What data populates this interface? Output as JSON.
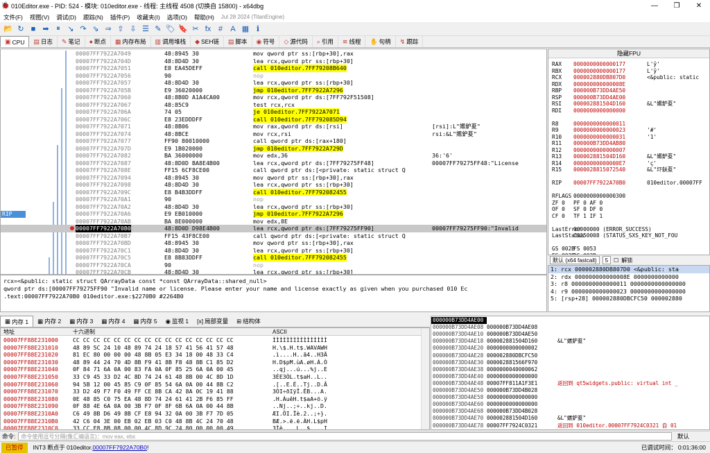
{
  "window": {
    "title": "010Editor.exe - PID: 524 - 模块: 010editor.exe - 线程: 主线程 4508 (切换自 15800) - x64dbg"
  },
  "menu": [
    "文件(F)",
    "视图(V)",
    "调试(D)",
    "跟踪(N)",
    "插件(P)",
    "收藏夹(I)",
    "选项(O)",
    "帮助(H)"
  ],
  "build": "Jul 28 2024 (TitanEngine)",
  "toolbar_icons": [
    "open-icon",
    "restart-icon",
    "close-icon",
    "run-icon",
    "pause-icon",
    "step-into-icon",
    "step-over-icon",
    "trace-into-icon",
    "trace-over-icon",
    "run-to-user-icon",
    "script-icon",
    "patch-icon",
    "comment-icon",
    "label-icon",
    "bookmark-icon",
    "function-icon",
    "fx",
    "hash",
    "A",
    "font-icon",
    "calc-icon",
    "info-icon"
  ],
  "toolbar_text": {
    "fx": "fx",
    "hash": "#",
    "A": "A"
  },
  "tabs": [
    "CPU",
    "日志",
    "笔记",
    "断点",
    "内存布局",
    "调用堆栈",
    "SEH链",
    "脚本",
    "符号",
    "源代码",
    "引用",
    "线程",
    "句柄",
    "跟踪"
  ],
  "disasm": [
    {
      "addr": "00007FF7922A7049",
      "bytes": "48:8945 30",
      "ins": "mov qword ptr ss:[rbp+30],rax",
      "cls": "",
      "cmt": ""
    },
    {
      "addr": "00007FF7922A704D",
      "bytes": "48:8D4D 30",
      "ins": "lea rcx,qword ptr ss:[rbp+30]",
      "cls": "",
      "cmt": ""
    },
    {
      "addr": "00007FF7922A7051",
      "bytes": "E8 EA45DEFF",
      "ins": "call 010editor.7FF79208B640",
      "cls": "hlc",
      "cmt": ""
    },
    {
      "addr": "00007FF7922A7056",
      "bytes": "90",
      "ins": "nop",
      "cls": "gray",
      "cmt": ""
    },
    {
      "addr": "00007FF7922A7057",
      "bytes": "48:8D4D 30",
      "ins": "lea rcx,qword ptr ss:[rbp+30]",
      "cls": "",
      "cmt": ""
    },
    {
      "addr": "00007FF7922A705B",
      "bytes": "E9 36020000",
      "ins": "jmp 010editor.7FF7922A7296",
      "cls": "hlc",
      "cmt": ""
    },
    {
      "addr": "00007FF7922A7060",
      "bytes": "48:8B0D A1A4CA00",
      "ins": "mov rcx,qword ptr ds:[7FF792F51508]",
      "cls": "",
      "cmt": ""
    },
    {
      "addr": "00007FF7922A7067",
      "bytes": "48:85C9",
      "ins": "test rcx,rcx",
      "cls": "",
      "cmt": ""
    },
    {
      "addr": "00007FF7922A706A",
      "bytes": "74 05",
      "ins": "je 010editor.7FF7922A7071",
      "cls": "hlc",
      "cmt": ""
    },
    {
      "addr": "00007FF7922A706C",
      "bytes": "E8 23EDDDFF",
      "ins": "call 010editor.7FF792085D94",
      "cls": "hlc",
      "cmt": ""
    },
    {
      "addr": "00007FF7922A7071",
      "bytes": "48:8B06",
      "ins": "mov rax,qword ptr ds:[rsi]",
      "cls": "",
      "cmt": "[rsi]:L\"嬺鈩荾\""
    },
    {
      "addr": "00007FF7922A7074",
      "bytes": "48:8BCE",
      "ins": "mov rcx,rsi",
      "cls": "",
      "cmt": "rsi:&L\"嬺鈩荾\""
    },
    {
      "addr": "00007FF7922A7077",
      "bytes": "FF90 80010000",
      "ins": "call qword ptr ds:[rax+180]",
      "cls": "",
      "cmt": ""
    },
    {
      "addr": "00007FF7922A707D",
      "bytes": "E9 1B020000",
      "ins": "jmp 010editor.7FF7922A729D",
      "cls": "hlc",
      "cmt": ""
    },
    {
      "addr": "00007FF7922A7082",
      "bytes": "BA 36000000",
      "ins": "mov edx,36",
      "cls": "",
      "cmt": "36:'6'"
    },
    {
      "addr": "00007FF7922A7087",
      "bytes": "48:8D0D BA8E4B00",
      "ins": "lea rcx,qword ptr ds:[7FF79275FF48]",
      "cls": "",
      "cmt": "00007FF79275FF48:\"License"
    },
    {
      "addr": "00007FF7922A708E",
      "bytes": "FF15 6CF8CE00",
      "ins": "call qword ptr ds:[<private: static struct Q",
      "cls": "",
      "cmt": ""
    },
    {
      "addr": "00007FF7922A7094",
      "bytes": "48:8945 30",
      "ins": "mov qword ptr ss:[rbp+30],rax",
      "cls": "",
      "cmt": ""
    },
    {
      "addr": "00007FF7922A7098",
      "bytes": "48:8D4D 30",
      "ins": "lea rcx,qword ptr ss:[rbp+30]",
      "cls": "",
      "cmt": ""
    },
    {
      "addr": "00007FF7922A709C",
      "bytes": "E8 B4B3DDFF",
      "ins": "call 010editor.7FF792082455",
      "cls": "hlc",
      "cmt": ""
    },
    {
      "addr": "00007FF7922A70A1",
      "bytes": "90",
      "ins": "nop",
      "cls": "gray",
      "cmt": ""
    },
    {
      "addr": "00007FF7922A70A2",
      "bytes": "48:8D4D 30",
      "ins": "lea rcx,qword ptr ss:[rbp+30]",
      "cls": "",
      "cmt": ""
    },
    {
      "addr": "00007FF7922A70A6",
      "bytes": "E9 EB010000",
      "ins": "jmp 010editor.7FF7922A7296",
      "cls": "hlc",
      "cmt": ""
    },
    {
      "addr": "00007FF7922A70AB",
      "bytes": "BA 8E000000",
      "ins": "mov edx,8E",
      "cls": "",
      "cmt": ""
    },
    {
      "addr": "00007FF7922A70B0",
      "bytes": "48:8D0D D98E4B00",
      "ins": "lea rcx,qword ptr ds:[7FF79275FF90]",
      "cls": "",
      "cmt": "00007FF79275FF90:\"Invalid"
    },
    {
      "addr": "00007FF7922A70B7",
      "bytes": "FF15 43F8CE00",
      "ins": "call qword ptr ds:[<private: static struct Q",
      "cls": "",
      "cmt": ""
    },
    {
      "addr": "00007FF7922A70BD",
      "bytes": "48:8945 30",
      "ins": "mov qword ptr ss:[rbp+30],rax",
      "cls": "",
      "cmt": ""
    },
    {
      "addr": "00007FF7922A70C1",
      "bytes": "48:8D4D 30",
      "ins": "lea rcx,qword ptr ss:[rbp+30]",
      "cls": "",
      "cmt": ""
    },
    {
      "addr": "00007FF7922A70C5",
      "bytes": "E8 8B83DDFF",
      "ins": "call 010editor.7FF792082455",
      "cls": "hlc",
      "cmt": ""
    },
    {
      "addr": "00007FF7922A70CA",
      "bytes": "90",
      "ins": "nop",
      "cls": "gray",
      "cmt": ""
    },
    {
      "addr": "00007FF7922A70CB",
      "bytes": "48:8D4D 30",
      "ins": "lea rcx,qword ptr ss:[rbp+30]",
      "cls": "",
      "cmt": ""
    },
    {
      "addr": "00007FF7922A70CF",
      "bytes": "E9 C2010000",
      "ins": "jmp 010editor.7FF7922A7296",
      "cls": "hlc",
      "cmt": ""
    }
  ],
  "rip_label": "RIP",
  "rip_row": 24,
  "regs_header": "隐藏FPU",
  "regs": [
    {
      "n": "RAX",
      "v": "0000000000000177",
      "c": "L'ŷ'"
    },
    {
      "n": "RBX",
      "v": "0000000000000177",
      "c": "L'ŷ'"
    },
    {
      "n": "RCX",
      "v": "000002880DB807D0",
      "c": "<&public: static"
    },
    {
      "n": "RDX",
      "v": "000000000000008E",
      "c": ""
    },
    {
      "n": "RBP",
      "v": "000000B73DD4AE50",
      "c": ""
    },
    {
      "n": "RSP",
      "v": "000000B73DD4AE00",
      "c": ""
    },
    {
      "n": "RSI",
      "v": "000002881504D160",
      "c": "&L\"嬺鈩荾\""
    },
    {
      "n": "RDI",
      "v": "0000000000000000",
      "c": ""
    },
    {
      "n": "",
      "v": "",
      "c": ""
    },
    {
      "n": "R8",
      "v": "0000000000000011",
      "c": ""
    },
    {
      "n": "R9",
      "v": "0000000000000023",
      "c": "'#'"
    },
    {
      "n": "R10",
      "v": "0000000000000031",
      "c": "'1'"
    },
    {
      "n": "R11",
      "v": "000000B73DD4AB80",
      "c": ""
    },
    {
      "n": "R12",
      "v": "0000000000000007",
      "c": ""
    },
    {
      "n": "R13",
      "v": "000002881504D160",
      "c": "&L\"嬺鈩荾\""
    },
    {
      "n": "R14",
      "v": "00000000000000E7",
      "c": "'ç'"
    },
    {
      "n": "R15",
      "v": "0000028815072540",
      "c": "&L\"圷鈇荾\""
    },
    {
      "n": "",
      "v": "",
      "c": ""
    },
    {
      "n": "RIP",
      "v": "00007FF7922A70B0",
      "c": "010editor.00007FF"
    },
    {
      "n": "",
      "v": "",
      "c": ""
    },
    {
      "n": "RFLAGS",
      "v": "0000000000000300",
      "c": ""
    },
    {
      "n": "ZF 0",
      "v": "PF 0   AF 0",
      "c": ""
    },
    {
      "n": "OF 0",
      "v": "SF 0   DF 0",
      "c": ""
    },
    {
      "n": "CF 0",
      "v": "TF 1   IF 1",
      "c": ""
    },
    {
      "n": "",
      "v": "",
      "c": ""
    },
    {
      "n": "LastError",
      "v": "  00000000 (ERROR_SUCCESS)",
      "c": ""
    },
    {
      "n": "LastStatus",
      "v": "  C0150008 (STATUS_SXS_KEY_NOT_FOU",
      "c": ""
    },
    {
      "n": "",
      "v": "",
      "c": ""
    },
    {
      "n": "GS 002B",
      "v": "FS 0053",
      "c": ""
    },
    {
      "n": "ES 002B",
      "v": "DS 002B",
      "c": ""
    }
  ],
  "fastcall": {
    "label": "默认 (x64 fastcall)",
    "count": "5",
    "unlock": "解锁"
  },
  "args": [
    "1: rcx 000002880DB807D0 <&public: sta",
    "2: rdx 000000000000008E 0000000000000",
    "3: r8 0000000000000011 0000000000000000",
    "4: r9 0000000000000023 0000000000000000",
    "5: [rsp+28] 000002880DBCFC50 000002880"
  ],
  "info": {
    "l1": "rcx=<&public: static struct QArrayData const *const QArrayData::shared_null>",
    "l2": "qword ptr ds:[00007FF79275FF90 \"Invalid name or license. Please enter your name and license exactly as given when you purchased 010 Ec",
    "l3": "",
    ".text": ".text:00007FF7922A70B0 010editor.exe:$2270B0 #2264B0"
  },
  "dumptabs": [
    "内存 1",
    "内存 2",
    "内存 3",
    "内存 4",
    "内存 5",
    "监视 1",
    "局部变量",
    "结构体"
  ],
  "dump_headers": {
    "addr": "地址",
    "hex": "十六进制",
    "ascii": "ASCII"
  },
  "dump": [
    {
      "a": "00007FF88E231000",
      "h": "CC CC CC CC CC CC CC CC CC CC CC CC CC CC CC CC",
      "s": "ÌÌÌÌÌÌÌÌÌÌÌÌÌÌÌÌ"
    },
    {
      "a": "00007FF88E231010",
      "h": "48 89 5C 24 10 48 89 74 24 18 57 41 56 41 57 48",
      "s": "H.\\$.H.t$.WAVAWH"
    },
    {
      "a": "00007FF88E231020",
      "h": "81 EC 80 00 00 00 48 8B 05 E3 34 18 00 48 33 C4",
      "s": ".ì....H..ã4..H3Ä"
    },
    {
      "a": "00007FF88E231030",
      "h": "48 89 44 24 70 4D 8B F9 41 8B F8 48 8B C1 85 D2",
      "s": "H.D$pM.ùA.øH.Á.Ò"
    },
    {
      "a": "00007FF88E231040",
      "h": "0F 84 71 6A 0A 00 83 FA 0A 0F 85 25 6A 0A 00 45",
      "s": "..qj...ú...%j..E"
    },
    {
      "a": "00007FF88E231050",
      "h": "33 C9 45 33 D2 4C 8D 74 24 61 48 8B 00 4C 8D 1D",
      "s": "3ÉE3ÒL.t$aH..L.."
    },
    {
      "a": "00007FF88E231060",
      "h": "94 5B 12 00 45 85 C9 0F 85 54 6A 0A 00 44 8B C2",
      "s": ".[..E.É..Tj..D.Â"
    },
    {
      "a": "00007FF88E231070",
      "h": "33 D2 49 F7 F0 49 FF CE 8B CA 42 8A 0C 19 41 88",
      "s": "3ÒI÷ðIÿÎ.ÊB...A."
    },
    {
      "a": "00007FF88E231080",
      "h": "0E 48 85 C0 75 EA 48 8D 74 24 61 41 2B F6 85 FF",
      "s": ".H.ÀuêH.t$aA+ö.ÿ"
    },
    {
      "a": "00007FF88E231090",
      "h": "0F 88 4E 6A 0A 00 3B F7 0F 8F 6B 6A 0A 00 44 8B",
      "s": "..Nj..;÷..kj..D."
    },
    {
      "a": "00007FF88E2310A0",
      "h": "C6 49 8B D6 49 8B CF E8 94 32 0A 00 3B F7 7D 05",
      "s": "ÆI.ÖI.Ïè.2..;÷}."
    },
    {
      "a": "00007FF88E2310B0",
      "h": "42 C6 04 3E 00 EB 02 EB 03 C0 48 8B 4C 24 70 48",
      "s": "BÆ.>.ë.ë.ÀH.L$pH"
    },
    {
      "a": "00007FF88E2310C0",
      "h": "33 CC E8 8B 08 00 00 4C 8D 9C 24 80 00 00 00 49",
      "s": "3Ìè....L..$....I"
    },
    {
      "a": "00007FF88E2310D0",
      "h": "8B 5B 28 49 8B 73 30 49 8B E3 41 5F 41 5E 5F C3",
      "s": ".[(I.s0I.ãA_A^_Ã"
    }
  ],
  "stack": [
    {
      "a": "000000B73DD4AE00",
      "v": "000000B73DD4AE00",
      "c": ""
    },
    {
      "a": "000000B73DD4AE08",
      "v": "000000B73DD4AE08",
      "c": ""
    },
    {
      "a": "000000B73DD4AE10",
      "v": "000000B73DD4AE50",
      "c": ""
    },
    {
      "a": "000000B73DD4AE18",
      "v": "000002881504D160",
      "c": "&L\"嬺鈩荾\""
    },
    {
      "a": "000000B73DD4AE20",
      "v": "0000000000000002",
      "c": ""
    },
    {
      "a": "000000B73DD4AE28",
      "v": "000002880DBCFC50",
      "c": ""
    },
    {
      "a": "000000B73DD4AE30",
      "v": "000002881566F970",
      "c": ""
    },
    {
      "a": "000000B73DD4AE38",
      "v": "0000000040000062",
      "c": ""
    },
    {
      "a": "000000B73DD4AE40",
      "v": "0000000000000000",
      "c": ""
    },
    {
      "a": "000000B73DD4AE48",
      "v": "00007FF811A1F3E1",
      "c": "返回到 qt5widgets.public: virtual int _"
    },
    {
      "a": "000000B73DD4AE50",
      "v": "000000B73DD4B028",
      "c": ""
    },
    {
      "a": "000000B73DD4AE58",
      "v": "0000000000000000",
      "c": ""
    },
    {
      "a": "000000B73DD4AE60",
      "v": "0000000000000000",
      "c": ""
    },
    {
      "a": "000000B73DD4AE68",
      "v": "000000B73DD4B028",
      "c": ""
    },
    {
      "a": "000000B73DD4AE70",
      "v": "000002881504D160",
      "c": "&L\"嬺鈩荾\""
    },
    {
      "a": "000000B73DD4AE78",
      "v": "00007FF7924C0321",
      "c": "返回到 010editor.00007FF7924C0321 自 01"
    }
  ],
  "cmd": {
    "label": "命令:",
    "placeholder": "命令使用逗号分隔(像汇编语言)：mov eax, ebx",
    "right": "默认"
  },
  "status": {
    "state": "已暂停",
    "msg_pre": "INT3 断点于 010editor.",
    "msg_link": "00007FF7922A70B0",
    "msg_post": "!",
    "time_label": "已调试时间：",
    "time": "0:01:36:00"
  }
}
